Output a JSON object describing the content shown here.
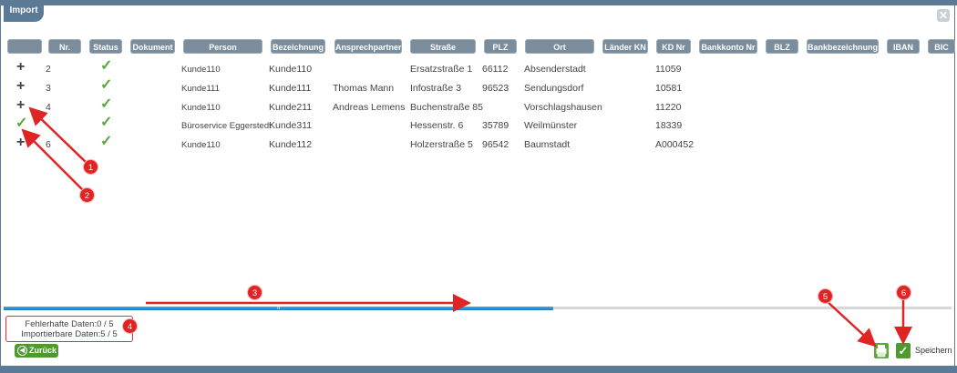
{
  "window": {
    "title": "Import",
    "close_icon": "close-icon"
  },
  "columns": [
    "",
    "Nr.",
    "Status",
    "Dokument",
    "Person",
    "Bezeichnung",
    "Ansprechpartner",
    "Straße",
    "PLZ",
    "Ort",
    "Länder KN",
    "KD Nr",
    "Bankkonto Nr",
    "BLZ",
    "Bankbezeichnung",
    "IBAN",
    "BIC"
  ],
  "rows": [
    {
      "action": "plus",
      "nr": "2",
      "status": "check",
      "person": "Kunde110",
      "bezeichnung": "Kunde110",
      "ansprechpartner": "",
      "strasse": "Ersatzstraße 1",
      "plz": "66112",
      "ort": "Absenderstadt",
      "kdnr": "11059"
    },
    {
      "action": "plus",
      "nr": "3",
      "status": "check",
      "person": "Kunde111",
      "bezeichnung": "Kunde111",
      "ansprechpartner": "Thomas Mann",
      "strasse": "Infostraße 3",
      "plz": "96523",
      "ort": "Sendungsdorf",
      "kdnr": "10581"
    },
    {
      "action": "plus",
      "nr": "4",
      "status": "check",
      "person": "Kunde110",
      "bezeichnung": "Kunde211",
      "ansprechpartner": "Andreas Lemens",
      "strasse": "Buchenstraße 85",
      "plz": "",
      "ort": "Vorschlagshausen",
      "kdnr": "11220"
    },
    {
      "action": "check",
      "nr": "",
      "status": "check",
      "person": "Büroservice Eggerstedt",
      "bezeichnung": "Kunde311",
      "ansprechpartner": "",
      "strasse": "Hessenstr. 6",
      "plz": "35789",
      "ort": "Weilmünster",
      "kdnr": "18339"
    },
    {
      "action": "plus",
      "nr": "6",
      "status": "check",
      "person": "Kunde110",
      "bezeichnung": "Kunde112",
      "ansprechpartner": "",
      "strasse": "Holzerstraße 5",
      "plz": "96542",
      "ort": "Baumstadt",
      "kdnr": "A000452"
    }
  ],
  "scroll": {
    "position": 0.58
  },
  "summary": {
    "fehlerhaft": "Fehlerhafte Daten:0 / 5",
    "importierbar": "Importierbare Daten:5 / 5"
  },
  "footer": {
    "back_label": "Zurück",
    "save_label": "Speichern"
  },
  "annotations": [
    "1",
    "2",
    "3",
    "4",
    "5",
    "6"
  ],
  "colors": {
    "accent": "#5b7a95",
    "header": "#7b8d9c",
    "ok": "#5aa83a",
    "marker": "#e02424",
    "scroll": "#1b7cc0"
  }
}
